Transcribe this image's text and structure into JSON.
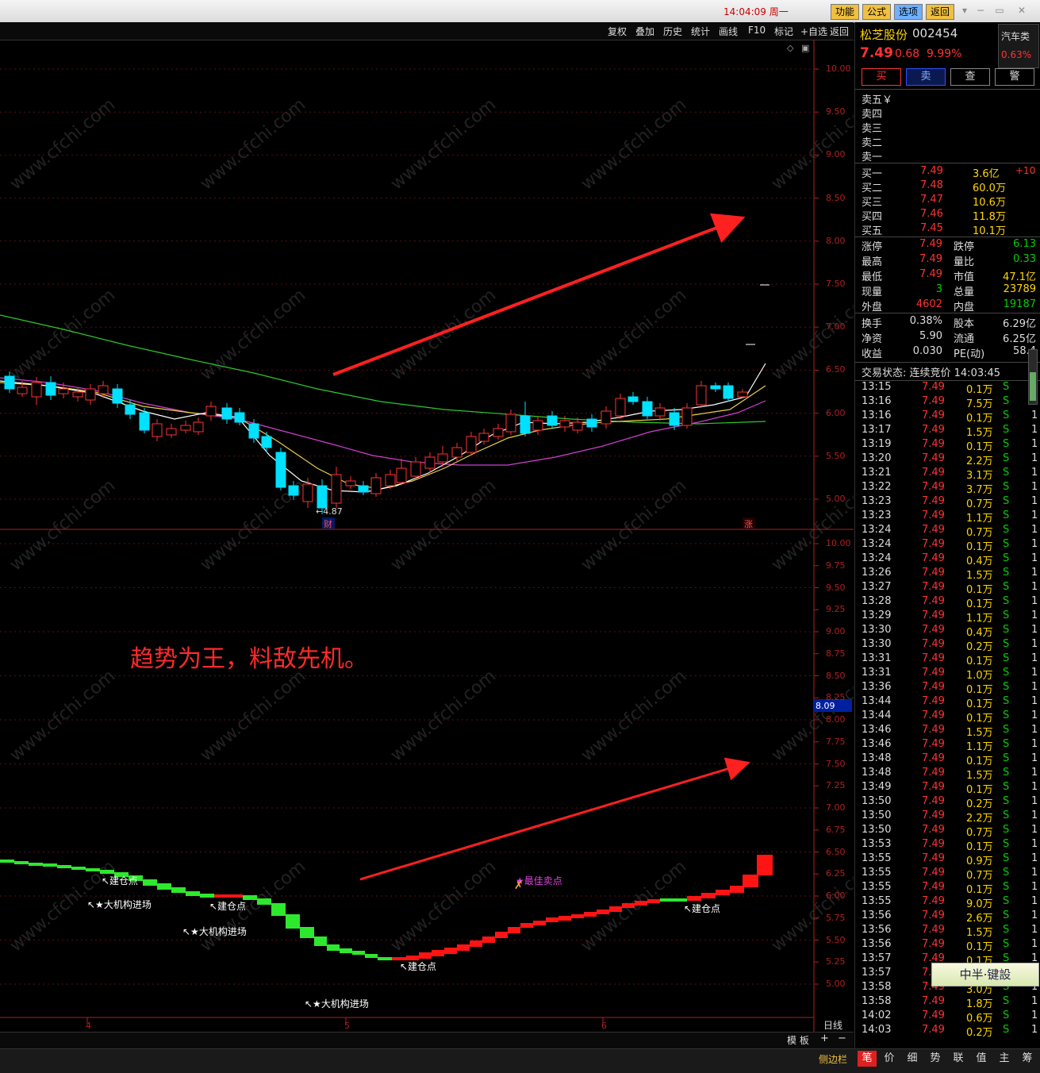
{
  "titlebar": {
    "clock": "14:04:09 周一",
    "buttons": [
      "功能",
      "公式",
      "选项",
      "返回"
    ]
  },
  "chart_toolbar": [
    "复权",
    "叠加",
    "历史",
    "统计",
    "画线",
    "F10",
    "标记",
    "+自选",
    "返回"
  ],
  "upper_axis": [
    "10.00",
    "9.50",
    "9.00",
    "8.50",
    "8.00",
    "7.50",
    "7.00",
    "6.50",
    "6.00",
    "5.50",
    "5.00"
  ],
  "lower_axis": [
    "10.00",
    "9.75",
    "9.50",
    "9.25",
    "9.00",
    "8.75",
    "8.50",
    "8.25",
    "8.00",
    "7.75",
    "7.50",
    "7.25",
    "7.00",
    "6.75",
    "6.50",
    "6.25",
    "6.00",
    "5.75",
    "5.50",
    "5.25",
    "5.00"
  ],
  "lower_current_value": "8.09",
  "low_marker": "←4.87",
  "cai_marker": "财",
  "zhang_marker": "涨",
  "slogan": "趋势为王，料敌先机。",
  "signals": {
    "jiancang1": "↖建仓点",
    "jiancang2": "↖建仓点",
    "jiancang3": "↖建仓点",
    "jiancang4": "↖建仓点",
    "dajigou1": "↖★大机构进场",
    "dajigou2": "↖★大机构进场",
    "dajigou3": "↖★大机构进场",
    "best_sell": "★最佳卖点"
  },
  "date_labels": [
    "4",
    "5",
    "6"
  ],
  "period": "日线",
  "bottom_bar": {
    "template": "模 板",
    "plus": "+",
    "minus": "−"
  },
  "sidebar_label": "侧边栏",
  "bottom_tabs": [
    "笔",
    "价",
    "细",
    "势",
    "联",
    "值",
    "主",
    "筹"
  ],
  "stock": {
    "name": "松芝股份",
    "code": "002454",
    "price": "7.49",
    "change": "0.68",
    "pct": "9.99%",
    "sector": "汽车类",
    "sector_pct": "0.63%",
    "actions": [
      "买",
      "卖",
      "查",
      "警"
    ]
  },
  "sell_levels": [
    "卖五￥",
    "卖四",
    "卖三",
    "卖二",
    "卖一"
  ],
  "buy_levels": [
    {
      "label": "买一",
      "price": "7.49",
      "vol": "3.6亿",
      "chg": "+10"
    },
    {
      "label": "买二",
      "price": "7.48",
      "vol": "60.0万",
      "chg": ""
    },
    {
      "label": "买三",
      "price": "7.47",
      "vol": "10.6万",
      "chg": ""
    },
    {
      "label": "买四",
      "price": "7.46",
      "vol": "11.8万",
      "chg": ""
    },
    {
      "label": "买五",
      "price": "7.45",
      "vol": "10.1万",
      "chg": ""
    }
  ],
  "quote_rows": [
    {
      "l1": "涨停",
      "v1": "7.49",
      "l2": "跌停",
      "v2": "6.13"
    },
    {
      "l1": "最高",
      "v1": "7.49",
      "l2": "量比",
      "v2": "0.33"
    },
    {
      "l1": "最低",
      "v1": "7.49",
      "l2": "市值",
      "v2": "47.1亿"
    },
    {
      "l1": "现量",
      "v1": "3",
      "l2": "总量",
      "v2": "23789"
    },
    {
      "l1": "外盘",
      "v1": "4602",
      "l2": "内盘",
      "v2": "19187"
    }
  ],
  "fin_rows": [
    {
      "l1": "换手",
      "v1": "0.38%",
      "l2": "股本",
      "v2": "6.29亿"
    },
    {
      "l1": "净资",
      "v1": "5.90",
      "l2": "流通",
      "v2": "6.25亿"
    },
    {
      "l1": "收益",
      "v1": "0.030",
      "l2": "PE(动)",
      "v2": "58.4"
    }
  ],
  "trade_status": "交易状态: 连续竞价 14:03:45",
  "ticks": [
    [
      "13:15",
      "7.49",
      "0.1万",
      "S",
      "1"
    ],
    [
      "13:16",
      "7.49",
      "7.5万",
      "S",
      "1"
    ],
    [
      "13:16",
      "7.49",
      "0.1万",
      "S",
      "1"
    ],
    [
      "13:17",
      "7.49",
      "1.5万",
      "S",
      "1"
    ],
    [
      "13:19",
      "7.49",
      "0.1万",
      "S",
      "1"
    ],
    [
      "13:20",
      "7.49",
      "2.2万",
      "S",
      "1"
    ],
    [
      "13:21",
      "7.49",
      "3.1万",
      "S",
      "1"
    ],
    [
      "13:22",
      "7.49",
      "3.7万",
      "S",
      "1"
    ],
    [
      "13:23",
      "7.49",
      "0.7万",
      "S",
      "1"
    ],
    [
      "13:23",
      "7.49",
      "1.1万",
      "S",
      "1"
    ],
    [
      "13:24",
      "7.49",
      "0.7万",
      "S",
      "1"
    ],
    [
      "13:24",
      "7.49",
      "0.1万",
      "S",
      "1"
    ],
    [
      "13:24",
      "7.49",
      "0.4万",
      "S",
      "1"
    ],
    [
      "13:26",
      "7.49",
      "1.5万",
      "S",
      "1"
    ],
    [
      "13:27",
      "7.49",
      "0.1万",
      "S",
      "1"
    ],
    [
      "13:28",
      "7.49",
      "0.1万",
      "S",
      "1"
    ],
    [
      "13:29",
      "7.49",
      "1.1万",
      "S",
      "1"
    ],
    [
      "13:30",
      "7.49",
      "0.4万",
      "S",
      "1"
    ],
    [
      "13:30",
      "7.49",
      "0.2万",
      "S",
      "1"
    ],
    [
      "13:31",
      "7.49",
      "0.1万",
      "S",
      "1"
    ],
    [
      "13:31",
      "7.49",
      "1.0万",
      "S",
      "1"
    ],
    [
      "13:36",
      "7.49",
      "0.1万",
      "S",
      "1"
    ],
    [
      "13:44",
      "7.49",
      "0.1万",
      "S",
      "1"
    ],
    [
      "13:44",
      "7.49",
      "0.1万",
      "S",
      "1"
    ],
    [
      "13:46",
      "7.49",
      "1.5万",
      "S",
      "1"
    ],
    [
      "13:46",
      "7.49",
      "1.1万",
      "S",
      "1"
    ],
    [
      "13:48",
      "7.49",
      "0.1万",
      "S",
      "1"
    ],
    [
      "13:48",
      "7.49",
      "1.5万",
      "S",
      "1"
    ],
    [
      "13:49",
      "7.49",
      "0.1万",
      "S",
      "1"
    ],
    [
      "13:50",
      "7.49",
      "0.2万",
      "S",
      "1"
    ],
    [
      "13:50",
      "7.49",
      "2.2万",
      "S",
      "1"
    ],
    [
      "13:50",
      "7.49",
      "0.7万",
      "S",
      "1"
    ],
    [
      "13:53",
      "7.49",
      "0.1万",
      "S",
      "1"
    ],
    [
      "13:55",
      "7.49",
      "0.9万",
      "S",
      "1"
    ],
    [
      "13:55",
      "7.49",
      "0.7万",
      "S",
      "1"
    ],
    [
      "13:55",
      "7.49",
      "0.1万",
      "S",
      "1"
    ],
    [
      "13:55",
      "7.49",
      "9.0万",
      "S",
      "1"
    ],
    [
      "13:56",
      "7.49",
      "2.6万",
      "S",
      "1"
    ],
    [
      "13:56",
      "7.49",
      "1.5万",
      "S",
      "1"
    ],
    [
      "13:56",
      "7.49",
      "0.1万",
      "S",
      "1"
    ],
    [
      "13:57",
      "7.49",
      "0.1万",
      "S",
      "1"
    ],
    [
      "13:57",
      "7.49",
      "3.8万",
      "S",
      "1"
    ],
    [
      "13:58",
      "7.49",
      "3.0万",
      "S",
      "1"
    ],
    [
      "13:58",
      "7.49",
      "1.8万",
      "S",
      "1"
    ],
    [
      "14:02",
      "7.49",
      "0.6万",
      "S",
      "1"
    ],
    [
      "14:03",
      "7.49",
      "0.2万",
      "S",
      "1"
    ]
  ],
  "overlay_stamp": "中半·键設"
}
